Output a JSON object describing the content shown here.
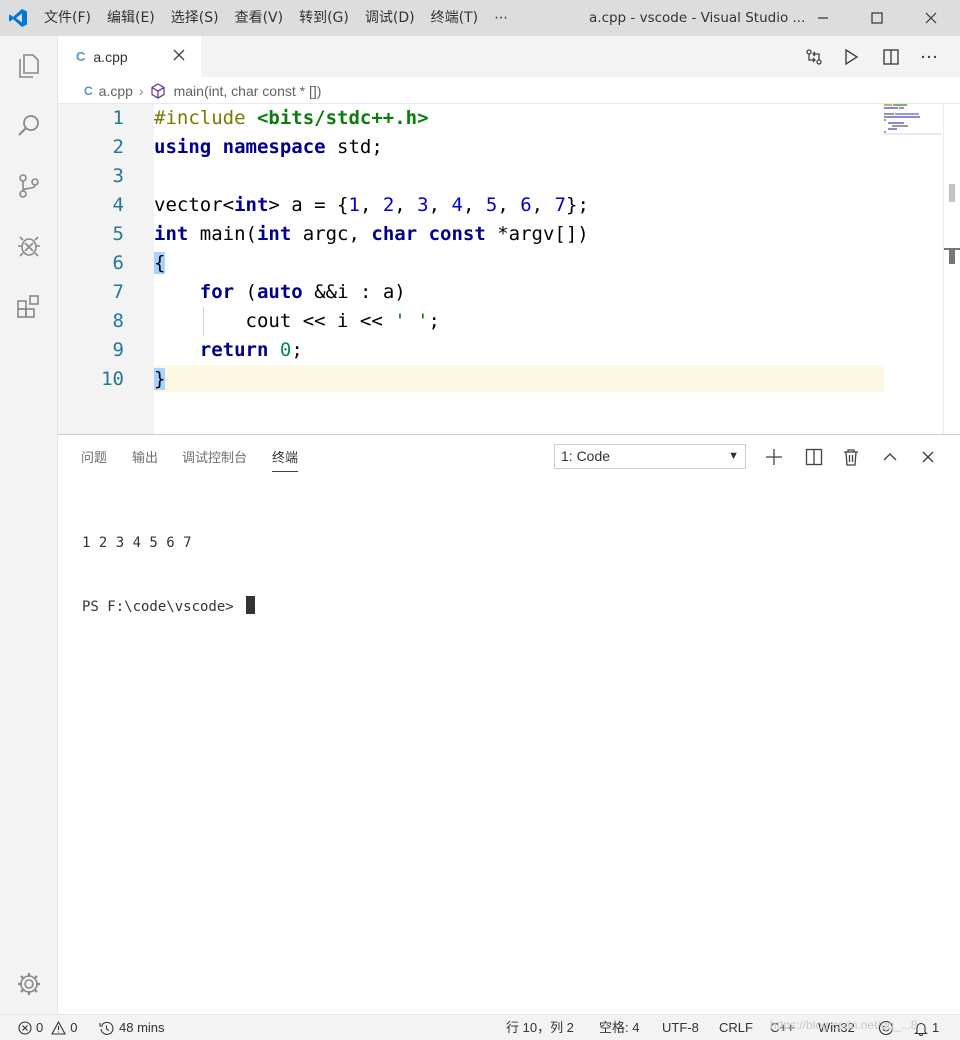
{
  "titlebar": {
    "menu": [
      "文件(F)",
      "编辑(E)",
      "选择(S)",
      "查看(V)",
      "转到(G)",
      "调试(D)",
      "终端(T)",
      "⋯"
    ],
    "title": "a.cpp - vscode - Visual Studio ..."
  },
  "tab": {
    "icon": "C",
    "label": "a.cpp"
  },
  "breadcrumb": {
    "file": "a.cpp",
    "symbol": "main(int, char const * [])"
  },
  "editor": {
    "line_numbers": [
      "1",
      "2",
      "3",
      "4",
      "5",
      "6",
      "7",
      "8",
      "9",
      "10"
    ],
    "current_line": 10
  },
  "panel": {
    "tabs": [
      "问题",
      "输出",
      "调试控制台",
      "终端"
    ],
    "active_tab": "终端",
    "terminal_select": "1: Code",
    "terminal_output": "1 2 3 4 5 6 7",
    "terminal_prompt": "PS F:\\code\\vscode> "
  },
  "statusbar": {
    "errors": "0",
    "warnings": "0",
    "time": "48 mins",
    "position": "行 10，列 2",
    "spaces": "空格: 4",
    "encoding": "UTF-8",
    "eol": "CRLF",
    "language": "C++",
    "platform": "Win32",
    "notifications": "1"
  },
  "watermark": "https://blog.csdn.net/qq_...8",
  "colors": {
    "keyword": "#0000ff",
    "preprocessor": "#7a7a00",
    "string": "#0a7d0a",
    "number": "#09885a",
    "linenumber": "#237893"
  }
}
